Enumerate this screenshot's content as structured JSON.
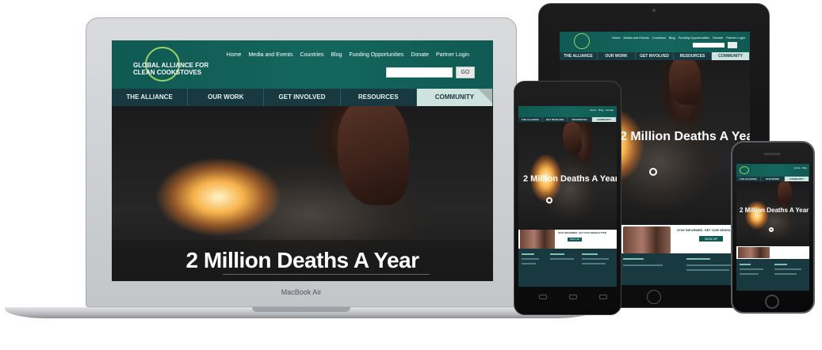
{
  "site": {
    "logo_line1": "GLOBAL ALLIANCE FOR",
    "logo_line2": "CLEAN COOKSTOVES",
    "top_nav": [
      "Home",
      "Media and Events",
      "Countries",
      "Blog",
      "Funding Opportunities",
      "Donate",
      "Partner Login"
    ],
    "search_button": "GO",
    "main_nav": [
      "THE ALLIANCE",
      "OUR WORK",
      "GET INVOLVED",
      "RESOURCES",
      "COMMUNITY"
    ],
    "hero_title": "2 Million Deaths A Year",
    "newsletter_cta": "STAY INFORMED. GET OUR NEWSLETTER",
    "signup_button": "SIGN UP"
  },
  "laptop": {
    "brand_label": "MacBook Air"
  },
  "colors": {
    "brand_teal": "#0f5a52",
    "nav_dark": "#18393f",
    "nav_active": "#cfe3de",
    "logo_green": "#9fd06a"
  },
  "icons": [
    "logo-ring-icon",
    "carousel-ring-icon",
    "corner-fold-icon",
    "home-button-icon"
  ]
}
